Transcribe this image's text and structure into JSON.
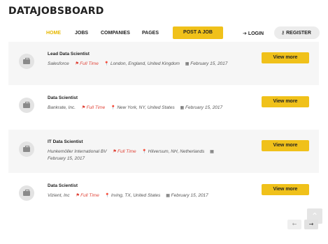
{
  "logo": "DATAJOBSBOARD",
  "nav": {
    "home": "HOME",
    "jobs": "JOBS",
    "companies": "COMPANIES",
    "pages": "PAGES",
    "post_job": "POST A JOB",
    "login": "LOGIN",
    "register": "REGISTER"
  },
  "jobs": [
    {
      "title": "Lead Data Scientist",
      "company": "Salesforce",
      "type": "Full Time",
      "location": "London, England, United Kingdom",
      "date": "February 15, 2017",
      "button": "View more"
    },
    {
      "title": "Data Scientist",
      "company": "Bankrate, Inc.",
      "type": "Full Time",
      "location": "New York, NY, United States",
      "date": "February 15, 2017",
      "button": "View more"
    },
    {
      "title": "IT Data Scientist",
      "company": "Hunkemöller International BV",
      "type": "Full Time",
      "location": "Hilversum, NH, Netherlands",
      "date": "February 15, 2017",
      "button": "View more"
    },
    {
      "title": "Data Scientist",
      "company": "Vizient, Inc",
      "type": "Full Time",
      "location": "Irving, TX, United States",
      "date": "February 15, 2017",
      "button": "View more"
    }
  ],
  "icons": {
    "login": "sign-in-icon",
    "register": "key-icon",
    "job": "briefcase-icon",
    "type": "bookmark-icon",
    "location": "map-marker-icon",
    "date": "calendar-icon",
    "scroll_top": "chevron-up-icon",
    "prev": "arrow-left-icon",
    "next": "arrow-right-icon"
  },
  "colors": {
    "accent": "#f0c11a",
    "full_time": "#e0453a",
    "active_nav": "#e6b800"
  }
}
